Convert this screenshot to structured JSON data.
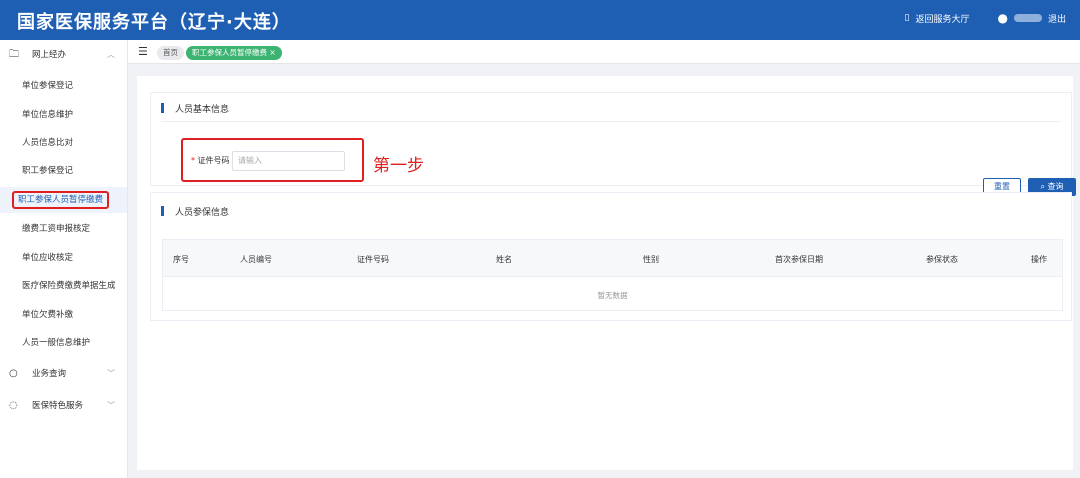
{
  "header": {
    "title": "国家医保服务平台（辽宁·大连）",
    "return_label": "返回服务大厅",
    "logout_label": "退出"
  },
  "sidebar": {
    "group1": "网上经办",
    "items": [
      "单位参保登记",
      "单位信息维护",
      "人员信息比对",
      "职工参保登记",
      "职工参保人员暂停缴费",
      "缴费工资申报核定",
      "单位应收核定",
      "医疗保险费缴费单据生成",
      "单位欠费补缴",
      "人员一般信息维护"
    ],
    "group2": "业务查询",
    "group3": "医保特色服务"
  },
  "tabs": {
    "home": "首页",
    "active": "职工参保人员暂停缴费",
    "close": "×"
  },
  "basic": {
    "title": "人员基本信息",
    "required": "*",
    "id_label": "证件号码",
    "id_placeholder": "请输入",
    "annotation": "第一步",
    "reset": "重置",
    "query": "查询"
  },
  "insured": {
    "title": "人员参保信息",
    "columns": [
      "序号",
      "人员编号",
      "证件号码",
      "姓名",
      "性别",
      "首次参保日期",
      "参保状态",
      "操作"
    ],
    "empty": "暂无数据"
  }
}
